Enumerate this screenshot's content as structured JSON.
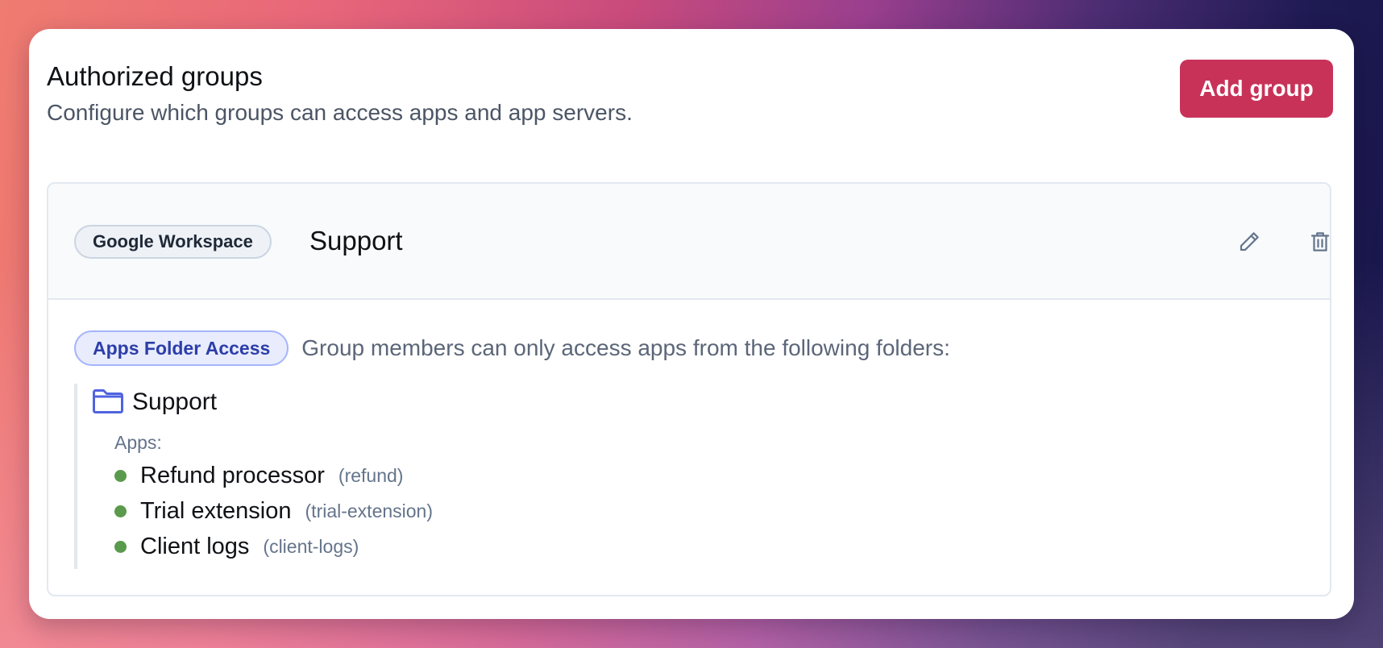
{
  "header": {
    "title": "Authorized groups",
    "subtitle": "Configure which groups can access apps and app servers.",
    "add_button_label": "Add group"
  },
  "colors": {
    "accent": "#c83258",
    "badge_blue": "#2c3ea8",
    "status_green": "#5a9a4c",
    "folder_blue": "#4f63e0"
  },
  "group": {
    "provider": "Google Workspace",
    "name": "Support",
    "actions": [
      {
        "name": "edit",
        "icon": "pencil-icon"
      },
      {
        "name": "delete",
        "icon": "trash-icon"
      }
    ],
    "access": {
      "badge": "Apps Folder Access",
      "description": "Group members can only access apps from the following folders:"
    },
    "folder": {
      "icon": "folder-icon",
      "name": "Support",
      "apps_label": "Apps:",
      "apps": [
        {
          "name": "Refund processor",
          "slug": "(refund)"
        },
        {
          "name": "Trial extension",
          "slug": "(trial-extension)"
        },
        {
          "name": "Client logs",
          "slug": "(client-logs)"
        }
      ]
    }
  }
}
